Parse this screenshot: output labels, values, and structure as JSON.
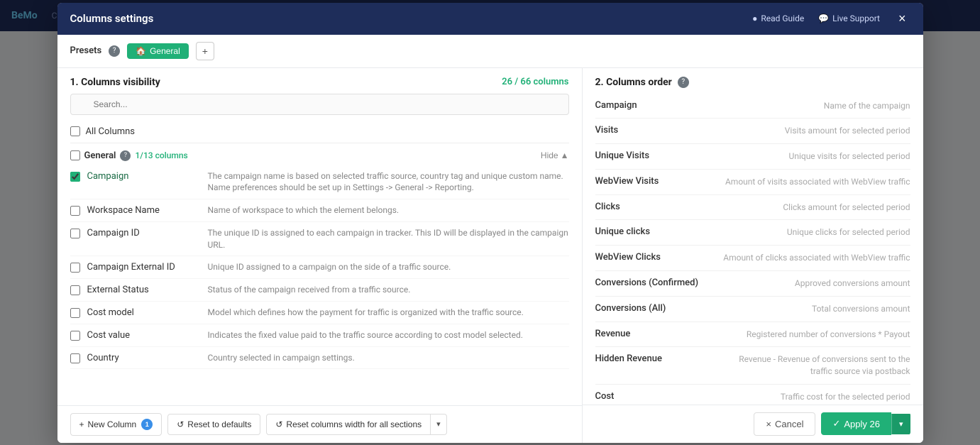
{
  "modal": {
    "title": "Columns settings",
    "header": {
      "read_guide": "Read Guide",
      "live_support": "Live Support",
      "close_label": "×"
    },
    "presets": {
      "label": "Presets",
      "help_icon": "?",
      "active_preset": "General",
      "home_icon": "🏠",
      "add_icon": "+"
    },
    "left_panel": {
      "section_title": "1. Columns visibility",
      "columns_count": "26 / 66 columns",
      "search_placeholder": "Search...",
      "all_columns_label": "All Columns",
      "group": {
        "name": "General",
        "help_icon": "?",
        "count": "1/13 columns",
        "hide_label": "Hide",
        "hide_icon": "▲"
      },
      "columns": [
        {
          "name": "Campaign",
          "description": "The campaign name is based on selected traffic source, country tag and unique custom name. Name preferences should be set up in Settings -> General -> Reporting.",
          "checked": true
        },
        {
          "name": "Workspace Name",
          "description": "Name of workspace to which the element belongs.",
          "checked": false
        },
        {
          "name": "Campaign ID",
          "description": "The unique ID is assigned to each campaign in tracker. This ID will be displayed in the campaign URL.",
          "checked": false
        },
        {
          "name": "Campaign External ID",
          "description": "Unique ID assigned to a campaign on the side of a traffic source.",
          "checked": false
        },
        {
          "name": "External Status",
          "description": "Status of the campaign received from a traffic source.",
          "checked": false
        },
        {
          "name": "Cost model",
          "description": "Model which defines how the payment for traffic is organized with the traffic source.",
          "checked": false
        },
        {
          "name": "Cost value",
          "description": "Indicates the fixed value paid to the traffic source according to cost model selected.",
          "checked": false
        },
        {
          "name": "Country",
          "description": "Country selected in campaign settings.",
          "checked": false
        }
      ],
      "footer": {
        "new_column_label": "New Column",
        "new_column_badge": "1",
        "reset_defaults_label": "Reset to defaults",
        "reset_width_label": "Reset columns width for all sections",
        "reset_icon": "↺",
        "dropdown_icon": "▾"
      }
    },
    "right_panel": {
      "section_title": "2. Columns order",
      "help_icon": "?",
      "columns": [
        {
          "name": "Campaign",
          "description": "Name of the campaign"
        },
        {
          "name": "Visits",
          "description": "Visits amount for selected period"
        },
        {
          "name": "Unique Visits",
          "description": "Unique visits for selected period"
        },
        {
          "name": "WebView Visits",
          "description": "Amount of visits associated with WebView traffic"
        },
        {
          "name": "Clicks",
          "description": "Clicks amount for selected period"
        },
        {
          "name": "Unique clicks",
          "description": "Unique clicks for selected period"
        },
        {
          "name": "WebView Clicks",
          "description": "Amount of clicks associated with WebView traffic"
        },
        {
          "name": "Conversions (Confirmed)",
          "description": "Approved conversions amount"
        },
        {
          "name": "Conversions (All)",
          "description": "Total conversions amount"
        },
        {
          "name": "Revenue",
          "description": "Registered number of conversions * Payout"
        },
        {
          "name": "Hidden Revenue",
          "description": "Revenue - Revenue of conversions sent to the traffic source via postback"
        },
        {
          "name": "Cost",
          "description": "Traffic cost for the selected period"
        }
      ]
    },
    "footer": {
      "cancel_label": "Cancel",
      "cancel_icon": "×",
      "apply_label": "Apply 26",
      "apply_icon": "✓",
      "apply_dropdown_icon": "▾"
    }
  }
}
